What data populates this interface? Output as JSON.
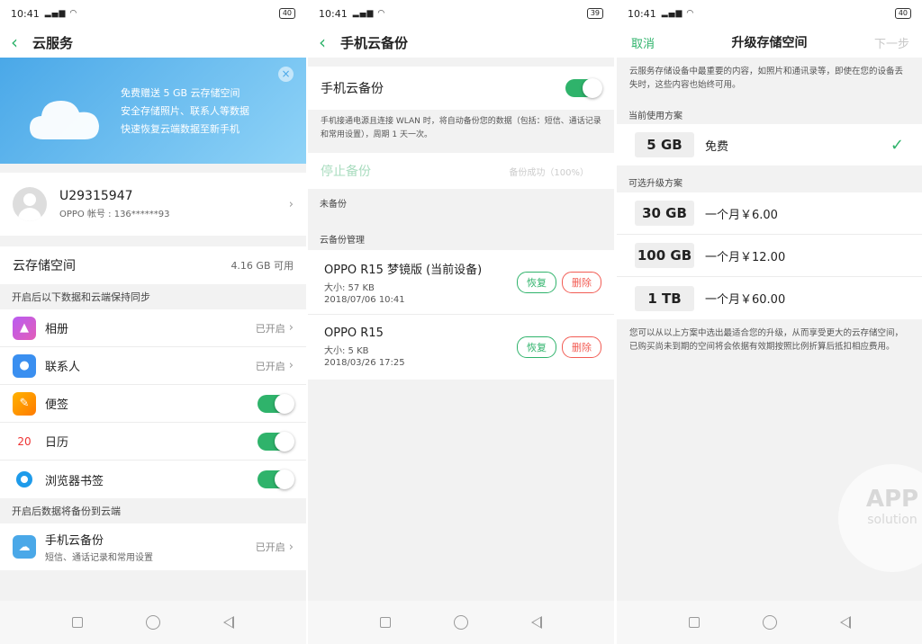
{
  "status": {
    "time": "10:41",
    "batt1": "40",
    "batt2": "39",
    "batt3": "40"
  },
  "p1": {
    "title": "云服务",
    "banner": [
      "免费赠送 5 GB 云存储空间",
      "安全存储照片、联系人等数据",
      "快速恢复云端数据至新手机"
    ],
    "account_name": "U29315947",
    "account_sub": "OPPO 帐号 : 136******93",
    "storage_label": "云存储空间",
    "storage_value": "4.16 GB 可用",
    "sync_section": "开启后以下数据和云端保持同步",
    "sync_items": [
      {
        "label": "相册",
        "value": "已开启"
      },
      {
        "label": "联系人",
        "value": "已开启"
      },
      {
        "label": "便签"
      },
      {
        "label": "日历",
        "icon_text": "20"
      },
      {
        "label": "浏览器书签"
      }
    ],
    "backup_section": "开启后数据将备份到云端",
    "backup_title": "手机云备份",
    "backup_sub": "短信、通话记录和常用设置",
    "backup_value": "已开启"
  },
  "p2": {
    "title": "手机云备份",
    "toggle_label": "手机云备份",
    "desc": "手机接通电源且连接 WLAN 时，将自动备份您的数据（包括：短信、通话记录和常用设置），周期 1 天一次。",
    "stop_label": "停止备份",
    "stop_status": "备份成功（100%）",
    "unbacked": "未备份",
    "manage_section": "云备份管理",
    "devices": [
      {
        "name": "OPPO R15 梦镜版 (当前设备)",
        "size": "大小: 57 KB",
        "date": "2018/07/06 10:41"
      },
      {
        "name": "OPPO R15",
        "size": "大小: 5 KB",
        "date": "2018/03/26 17:25"
      }
    ],
    "restore_label": "恢复",
    "delete_label": "删除"
  },
  "p3": {
    "cancel": "取消",
    "title": "升级存储空间",
    "next": "下一步",
    "intro": "云服务存储设备中最重要的内容，如照片和通讯录等，即使在您的设备丢失时，这些内容也始终可用。",
    "current_section": "当前使用方案",
    "current_plan": {
      "size": "5 GB",
      "price": "免费"
    },
    "upgrade_section": "可选升级方案",
    "plans": [
      {
        "size": "30 GB",
        "price": "一个月￥6.00"
      },
      {
        "size": "100 GB",
        "price": "一个月￥12.00"
      },
      {
        "size": "1 TB",
        "price": "一个月￥60.00"
      }
    ],
    "footnote": "您可以从以上方案中选出最适合您的升级，从而享受更大的云存储空间，已购买尚未到期的空间将会依据有效期按照比例折算后抵扣相应费用。",
    "watermark_line1": "APP",
    "watermark_line2": "solution"
  },
  "colors": {
    "accent": "#2fb36b",
    "danger": "#f25c54",
    "banner": "#5bb6ee"
  }
}
